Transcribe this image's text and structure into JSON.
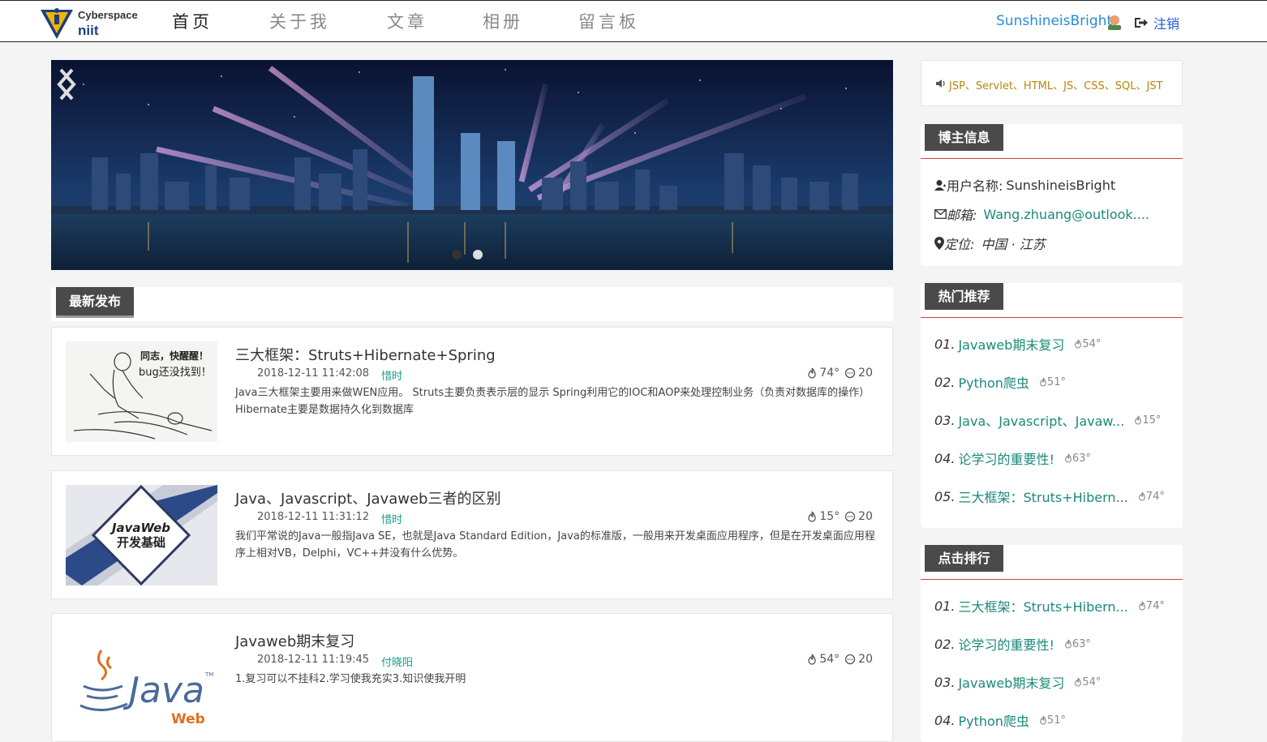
{
  "header": {
    "logo_line1": "Cyberspace",
    "logo_line2": "niit",
    "nav": [
      {
        "label": "首页",
        "active": true
      },
      {
        "label": "关于我",
        "active": false
      },
      {
        "label": "文章",
        "active": false
      },
      {
        "label": "相册",
        "active": false
      },
      {
        "label": "留言板",
        "active": false
      }
    ],
    "username": "SunshineisBright",
    "logout_label": "注销"
  },
  "banner": {
    "slide_count": 2,
    "active_slide": 1
  },
  "latest": {
    "title": "最新发布",
    "articles": [
      {
        "title": "三大框架：Struts+Hibernate+Spring",
        "date": "2018-12-11 11:42:08",
        "author": "惜时",
        "views": "74°",
        "comments": "20",
        "excerpt": "Java三大框架主要用来做WEN应用。 Struts主要负责表示层的显示 Spring利用它的IOC和AOP来处理控制业务（负责对数据库的操作） Hibernate主要是数据持久化到数据库",
        "thumb_text": [
          "同志，快醒醒！",
          "bug还没找到！"
        ]
      },
      {
        "title": "Java、Javascript、Javaweb三者的区别",
        "date": "2018-12-11 11:31:12",
        "author": "惜时",
        "views": "15°",
        "comments": "20",
        "excerpt": "我们平常说的Java一般指Java SE，也就是Java Standard Edition，Java的标准版，一般用来开发桌面应用程序，但是在开发桌面应用程序上相对VB，Delphi，VC++并没有什么优势。",
        "thumb_text": [
          "JavaWeb",
          "开发基础"
        ]
      },
      {
        "title": "Javaweb期末复习",
        "date": "2018-12-11 11:19:45",
        "author": "付晓阳",
        "views": "54°",
        "comments": "20",
        "excerpt": "1.复习可以不挂科2.学习使我充实3.知识使我开明",
        "thumb_text": [
          "Java",
          "TM",
          "Web"
        ]
      }
    ]
  },
  "sidebar": {
    "notice": "JSP、Servlet、HTML、JS、CSS、SQL、JST",
    "blogger": {
      "title": "博主信息",
      "username_label": "用户名称:",
      "username": "SunshineisBright",
      "email_label": "邮箱:",
      "email": "Wang.zhuang@outlook....",
      "location_label": "定位:",
      "location": "中国 · 江苏"
    },
    "hot": {
      "title": "热门推荐",
      "items": [
        {
          "num": "01.",
          "name": "Javaweb期末复习",
          "heat": "54°"
        },
        {
          "num": "02.",
          "name": "Python爬虫",
          "heat": "51°"
        },
        {
          "num": "03.",
          "name": "Java、Javascript、Javaw...",
          "heat": "15°"
        },
        {
          "num": "04.",
          "name": "论学习的重要性!",
          "heat": "63°"
        },
        {
          "num": "05.",
          "name": "三大框架：Struts+Hibern...",
          "heat": "74°"
        }
      ]
    },
    "clicks": {
      "title": "点击排行",
      "items": [
        {
          "num": "01.",
          "name": "三大框架：Struts+Hibern...",
          "heat": "74°"
        },
        {
          "num": "02.",
          "name": "论学习的重要性!",
          "heat": "63°"
        },
        {
          "num": "03.",
          "name": "Javaweb期末复习",
          "heat": "54°"
        },
        {
          "num": "04.",
          "name": "Python爬虫",
          "heat": "51°"
        }
      ]
    }
  }
}
